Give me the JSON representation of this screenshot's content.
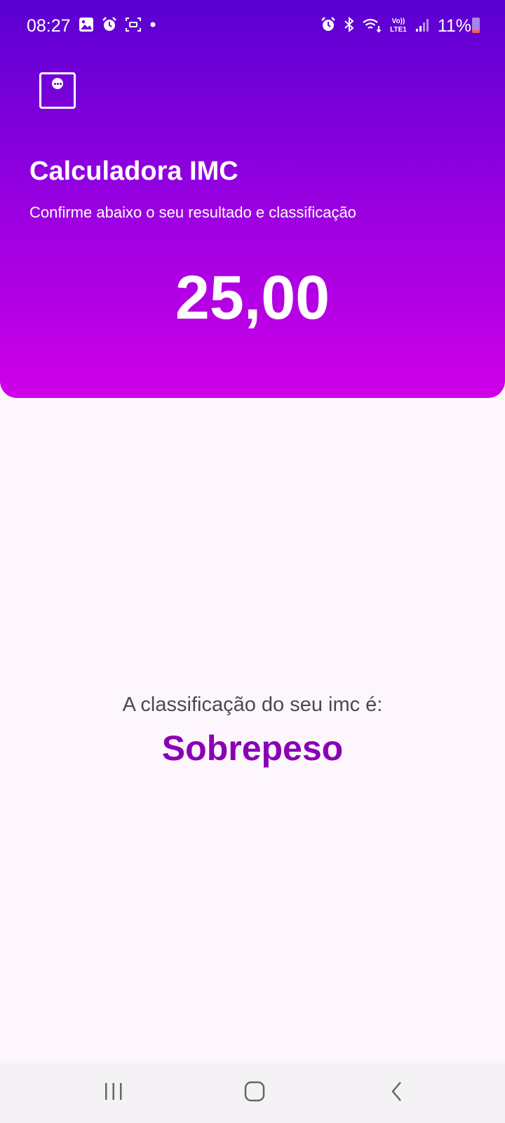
{
  "status_bar": {
    "time": "08:27",
    "battery_percent": "11%",
    "battery_level": 0.11,
    "left_icons": [
      "image-icon",
      "alarm-icon",
      "screen-capture-icon",
      "notification-dot-icon"
    ],
    "right_icons": [
      "alarm-icon",
      "bluetooth-icon",
      "wifi-icon",
      "volte-lte-icon",
      "signal-icon",
      "battery-icon"
    ],
    "volte_label": "Vo))",
    "lte_label": "LTE1"
  },
  "header": {
    "menu_icon": "chat-bubble-icon",
    "title": "Calculadora IMC",
    "subtitle": "Confirme abaixo o seu resultado e classificação",
    "result": "25,00",
    "gradient_colors": [
      "#5a00d2",
      "#9700e0",
      "#cf00e8"
    ]
  },
  "classification": {
    "label": "A classificação do seu imc é:",
    "value": "Sobrepeso",
    "value_color": "#8a00b5"
  },
  "nav_bar": {
    "buttons": [
      "recents-icon",
      "home-icon",
      "back-icon"
    ]
  }
}
